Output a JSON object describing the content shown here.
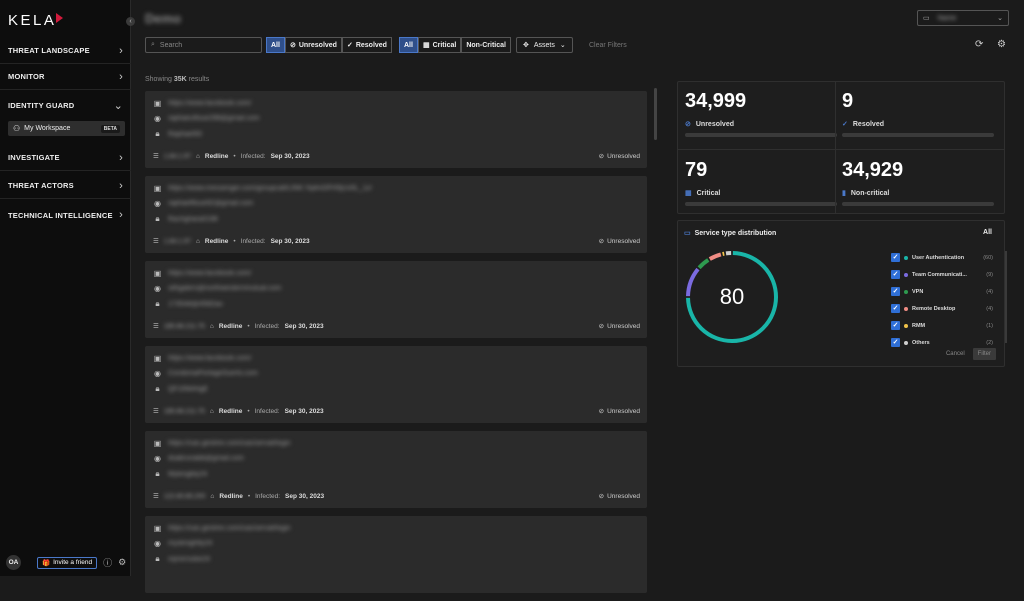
{
  "sidebar": {
    "logo": "KELA",
    "nav": [
      {
        "label": "THREAT LANDSCAPE",
        "chevron": "›"
      },
      {
        "label": "MONITOR",
        "chevron": "›"
      },
      {
        "label": "IDENTITY GUARD",
        "chevron": "⌄"
      },
      {
        "label": "INVESTIGATE",
        "chevron": "›"
      },
      {
        "label": "THREAT ACTORS",
        "chevron": "›"
      },
      {
        "label": "TECHNICAL INTELLIGENCE",
        "chevron": "›"
      }
    ],
    "workspace": {
      "label": "My Workspace",
      "badge": "BETA"
    },
    "avatar": "OA",
    "invite_label": "Invite a friend"
  },
  "header": {
    "title": "Demo",
    "org_name": "Name"
  },
  "filters": {
    "search_placeholder": "Search",
    "status_all": "All",
    "unresolved": "Unresolved",
    "resolved": "Resolved",
    "severity_all": "All",
    "critical": "Critical",
    "non_critical": "Non-Critical",
    "assets": "Assets",
    "clear": "Clear Filters"
  },
  "results": {
    "prefix": "Showing",
    "count": "35K",
    "suffix": "results"
  },
  "cards": [
    {
      "url": "https://www.facebook.com/",
      "user": "raphaeufloue298@gmail.com",
      "pass": "Raphael93",
      "ip": "1.84.1.97",
      "stealer": "Redline",
      "infected_label": "Infected:",
      "date": "Sep 30, 2023",
      "status": "Unresolved"
    },
    {
      "url": "https://www.messenger.com/groupcall/LINK:Yq4mDFH5jUx5L_1z/",
      "user": "raphaelfloue92@gmail.com",
      "pass": "Rachghara0198",
      "ip": "1.84.1.97",
      "stealer": "Redline",
      "infected_label": "Infected:",
      "date": "Sep 30, 2023",
      "status": "Unresolved"
    },
    {
      "url": "https://www.facebook.com/",
      "user": "silhgalers@northwesternmutual.com",
      "pass": "1735Alt@456Dav",
      "ip": "185.66.211.75",
      "stealer": "Redline",
      "infected_label": "Infected:",
      "date": "Sep 30, 2023",
      "status": "Unresolved"
    },
    {
      "url": "https://www.facebook.com/",
      "user": "CondoniaPortageSuerts.com",
      "pass": "QF1R84HgE",
      "ip": "185.66.211.75",
      "stealer": "Redline",
      "infected_label": "Infected:",
      "date": "Sep 30, 2023",
      "status": "Unresolved"
    },
    {
      "url": "https://cas.gestrex.com/cas/servat/login",
      "user": "dsabrunabb@gmail.com",
      "pass": "Mykingbty24",
      "ip": "122.80.85.200",
      "stealer": "Redline",
      "infected_label": "Infected:",
      "date": "Sep 30, 2023",
      "status": "Unresolved"
    },
    {
      "url": "https://cas.gestrex.com/cas/servat/login",
      "user": "mysknightly24",
      "pass": "mjmirrsxbe24",
      "ip": "",
      "stealer": "",
      "infected_label": "",
      "date": "",
      "status": ""
    }
  ],
  "stats": {
    "unresolved": {
      "value": "34,999",
      "label": "Unresolved"
    },
    "resolved": {
      "value": "9",
      "label": "Resolved"
    },
    "critical": {
      "value": "79",
      "label": "Critical"
    },
    "noncritical": {
      "value": "34,929",
      "label": "Non-critical"
    }
  },
  "service": {
    "title": "Service type distribution",
    "filter": "All",
    "total": "80",
    "items": [
      {
        "label": "User Authentication",
        "count": "(60)",
        "value": 60,
        "color": "#19b5a8"
      },
      {
        "label": "Team Communicati...",
        "count": "(9)",
        "value": 9,
        "color": "#7b6be0"
      },
      {
        "label": "VPN",
        "count": "(4)",
        "value": 4,
        "color": "#2e9a4f"
      },
      {
        "label": "Remote Desktop",
        "count": "(4)",
        "value": 4,
        "color": "#f08c84"
      },
      {
        "label": "RMM",
        "count": "(1)",
        "value": 1,
        "color": "#f0c24a"
      },
      {
        "label": "Others",
        "count": "(2)",
        "value": 2,
        "color": "#cfcfcf"
      }
    ],
    "cancel": "Cancel",
    "apply": "Filter"
  }
}
